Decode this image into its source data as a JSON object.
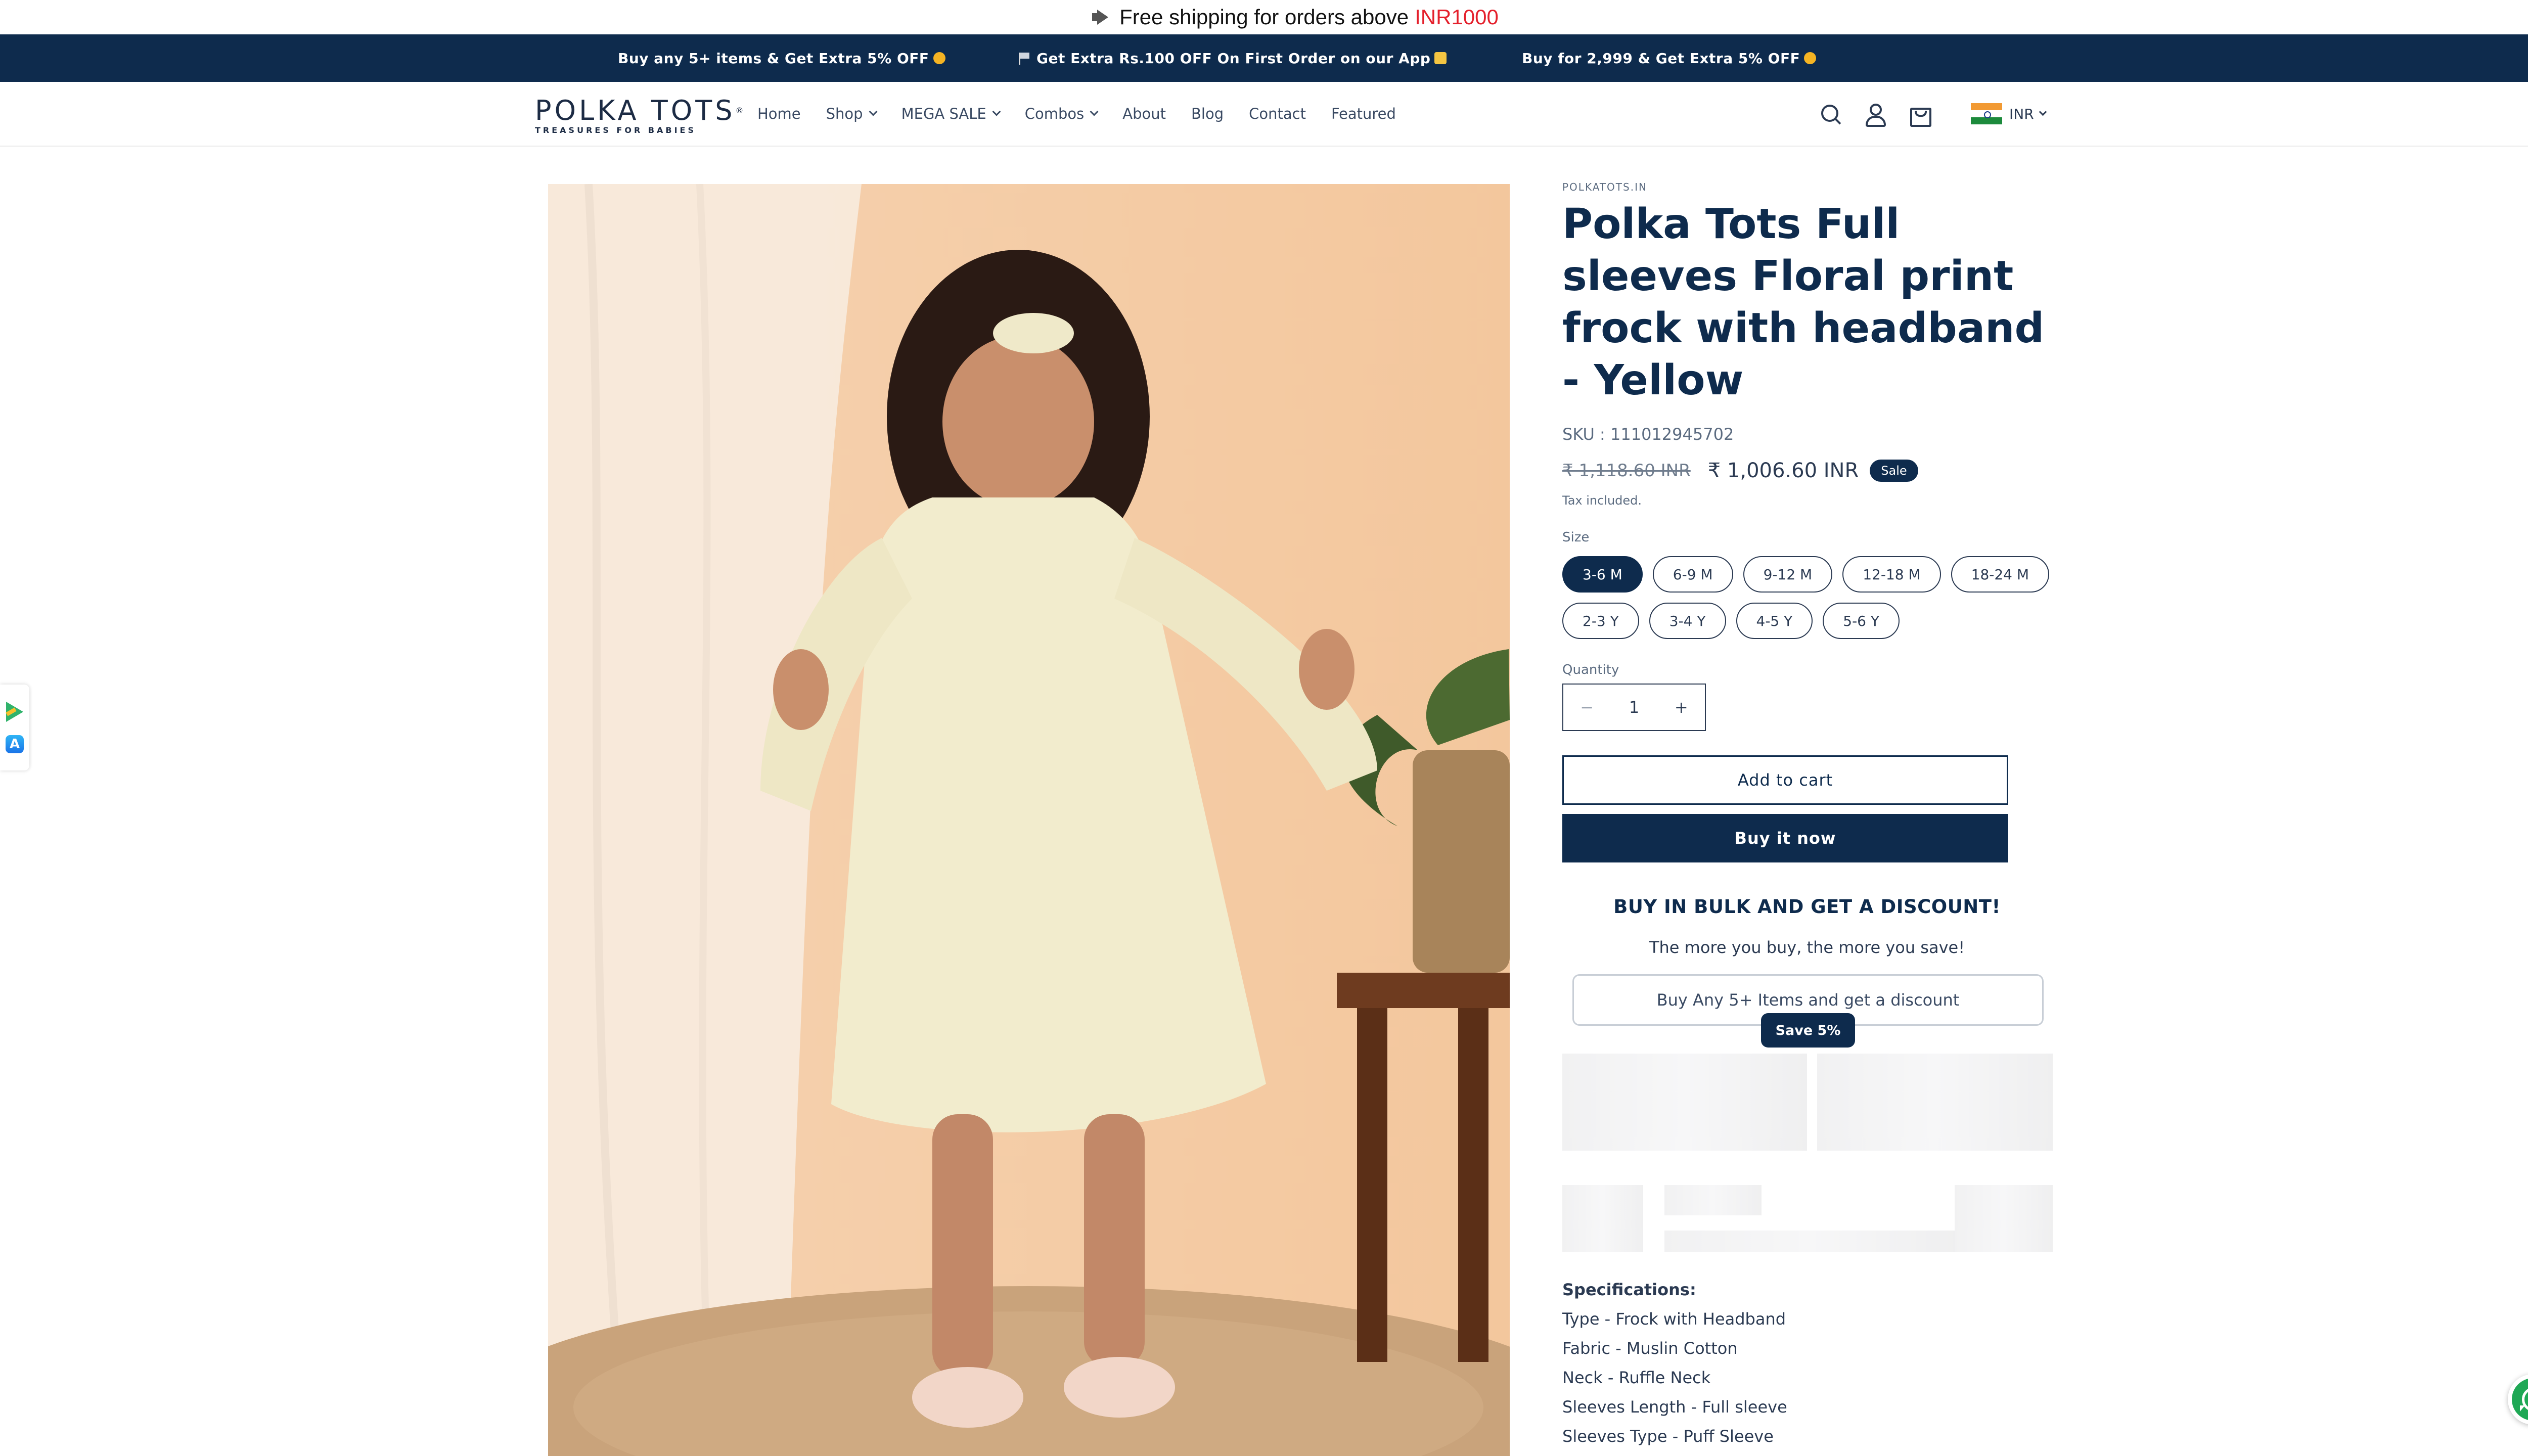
{
  "announcement": {
    "text": "Free shipping for orders above",
    "highlight": "INR1000",
    "icon": "megaphone-icon",
    "highlight_color": "#e4202c"
  },
  "promos": [
    {
      "text": "Buy any 5+ items & Get Extra 5% OFF",
      "icon": "smile-emoji"
    },
    {
      "text": "Get Extra Rs.100 OFF On First Order on our App",
      "icon": "flag-icon"
    },
    {
      "text": "Buy for 2,999 & Get Extra 5% OFF",
      "icon": "smile-emoji"
    }
  ],
  "brand": {
    "name": "POLKA TOTS",
    "tagline": "TREASURES FOR BABIES",
    "color": "#0e2b4d"
  },
  "nav": [
    {
      "label": "Home",
      "dropdown": false
    },
    {
      "label": "Shop",
      "dropdown": true
    },
    {
      "label": "MEGA SALE",
      "dropdown": true
    },
    {
      "label": "Combos",
      "dropdown": true
    },
    {
      "label": "About",
      "dropdown": false
    },
    {
      "label": "Blog",
      "dropdown": false
    },
    {
      "label": "Contact",
      "dropdown": false
    },
    {
      "label": "Featured",
      "dropdown": false
    }
  ],
  "header": {
    "currency": "INR"
  },
  "product": {
    "vendor": "POLKATOTS.IN",
    "title": "Polka Tots Full sleeves Floral print frock with headband - Yellow",
    "sku": "SKU : 111012945702",
    "price_compare": "₹ 1,118.60 INR",
    "price": "₹ 1,006.60 INR",
    "sale_badge": "Sale",
    "tax_note": "Tax included.",
    "size_label": "Size",
    "sizes": [
      "3-6 M",
      "6-9 M",
      "9-12 M",
      "12-18 M",
      "18-24 M",
      "2-3 Y",
      "3-4 Y",
      "4-5 Y",
      "5-6 Y"
    ],
    "selected_size": "3-6 M",
    "quantity_label": "Quantity",
    "quantity": "1",
    "qty_minus": "−",
    "qty_plus": "+",
    "add_to_cart": "Add to cart",
    "buy_now": "Buy it now"
  },
  "bulk": {
    "title": "BUY IN BULK AND GET A DISCOUNT!",
    "subtitle": "The more you buy, the more you save!",
    "offer": "Buy Any 5+ Items and get a discount",
    "badge": "Save 5%"
  },
  "specifications": {
    "title": "Specifications:",
    "items": [
      "Type - Frock with Headband",
      "Fabric - Muslin Cotton",
      "Neck - Ruffle Neck",
      "Sleeves Length - Full sleeve",
      "Sleeves Type - Puff Sleeve"
    ]
  },
  "side_apps": {
    "google_play_icon": "google-play-icon",
    "app_store_icon": "app-store-icon",
    "app_store_glyph": "A"
  },
  "floating": {
    "icon": "whatsapp-icon",
    "color": "#1fa855"
  }
}
